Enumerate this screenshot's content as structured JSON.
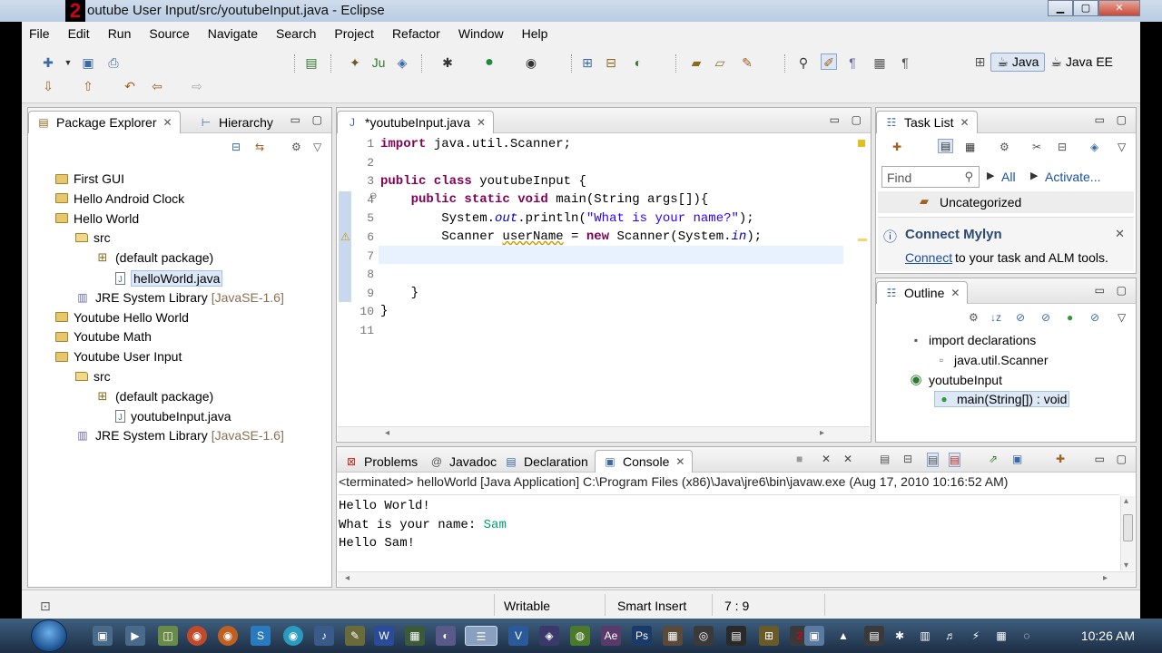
{
  "window": {
    "logo": "2",
    "title": "outube User Input/src/youtubeInput.java - Eclipse",
    "min": "▁",
    "max": "▢",
    "close": "✕"
  },
  "menu": [
    "File",
    "Edit",
    "Run",
    "Source",
    "Navigate",
    "Search",
    "Project",
    "Refactor",
    "Window",
    "Help"
  ],
  "perspectives": {
    "java": "Java",
    "javaee": "Java EE"
  },
  "package_explorer": {
    "tabs": [
      {
        "label": "Package Explorer"
      },
      {
        "label": "Hierarchy"
      }
    ],
    "items": [
      {
        "label": "First GUI",
        "type": "proj",
        "indent": 0
      },
      {
        "label": "Hello Android Clock",
        "type": "proj",
        "indent": 0
      },
      {
        "label": "Hello World",
        "type": "proj",
        "indent": 0
      },
      {
        "label": "src",
        "type": "src",
        "indent": 1
      },
      {
        "label": "(default package)",
        "type": "pkg",
        "indent": 2
      },
      {
        "label": "helloWorld.java",
        "type": "file",
        "indent": 3,
        "selected": true
      },
      {
        "label": "JRE System Library",
        "suffix": "[JavaSE-1.6]",
        "type": "lib",
        "indent": 1
      },
      {
        "label": "Youtube Hello World",
        "type": "proj",
        "indent": 0
      },
      {
        "label": "Youtube Math",
        "type": "proj",
        "indent": 0
      },
      {
        "label": "Youtube User Input",
        "type": "proj",
        "indent": 0
      },
      {
        "label": "src",
        "type": "src",
        "indent": 1
      },
      {
        "label": "(default package)",
        "type": "pkg",
        "indent": 2
      },
      {
        "label": "youtubeInput.java",
        "type": "file",
        "indent": 3
      },
      {
        "label": "JRE System Library",
        "suffix": "[JavaSE-1.6]",
        "type": "lib",
        "indent": 1
      }
    ]
  },
  "editor": {
    "tab": "*youtubeInput.java",
    "line_numbers": [
      "1",
      "2",
      "3",
      "4",
      "5",
      "6",
      "7",
      "8",
      "9",
      "10",
      "11"
    ]
  },
  "task_list": {
    "tab": "Task List",
    "find_placeholder": "Find",
    "all": "All",
    "activate": "Activate...",
    "uncategorized": "Uncategorized",
    "mylyn_title": "Connect Mylyn",
    "mylyn_link": "Connect",
    "mylyn_text": " to your task and ALM tools."
  },
  "outline": {
    "tab": "Outline",
    "items": [
      {
        "label": "import declarations",
        "indent": 0
      },
      {
        "label": "java.util.Scanner",
        "indent": 1
      },
      {
        "label": "youtubeInput",
        "indent": 0
      },
      {
        "label": "main(String[]) : void",
        "indent": 1
      }
    ]
  },
  "console": {
    "tabs": [
      {
        "label": "Problems"
      },
      {
        "label": "Javadoc"
      },
      {
        "label": "Declaration"
      },
      {
        "label": "Console"
      }
    ],
    "status": "<terminated> helloWorld [Java Application] C:\\Program Files (x86)\\Java\\jre6\\bin\\javaw.exe (Aug 17, 2010 10:16:52 AM)",
    "line1": "Hello World!",
    "line2_prefix": "What is your name: ",
    "line2_input": "Sam",
    "line3": "Hello Sam!"
  },
  "statusbar": {
    "writable": "Writable",
    "insert": "Smart Insert",
    "position": "7 : 9"
  },
  "taskbar": {
    "clock": "10:26 AM"
  },
  "colors": {
    "keyword": "#7f0055",
    "string": "#2a00ff",
    "field": "#0000c0",
    "console_input": "#00a070",
    "link": "#1a4fa0"
  }
}
